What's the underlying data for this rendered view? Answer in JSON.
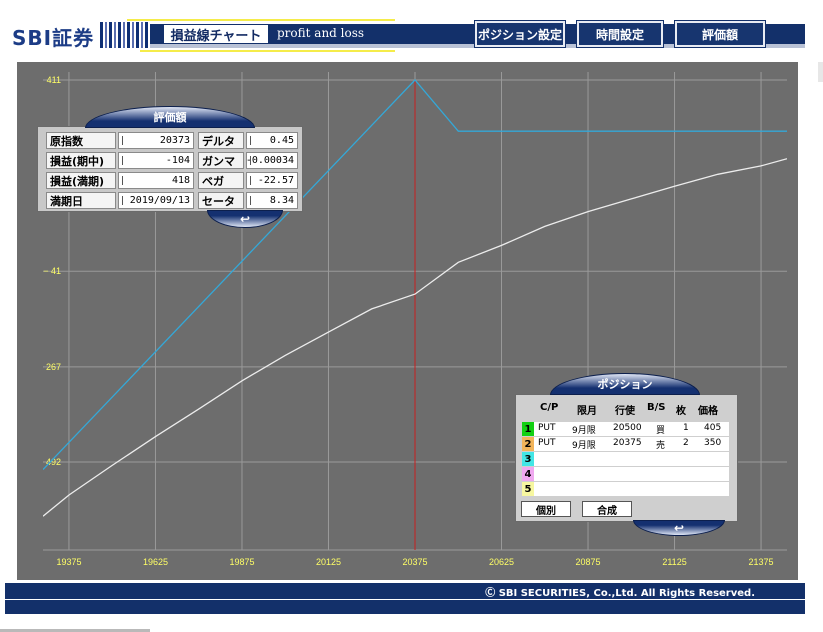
{
  "header": {
    "logo": "SBI証券",
    "title": "損益線チャート",
    "subtitle": "profit and loss",
    "nav": [
      {
        "label": "ポジション設定"
      },
      {
        "label": "時間設定"
      },
      {
        "label": "評価額"
      }
    ]
  },
  "colors": {
    "navy": "#13306a",
    "plot_bg": "#6d6d6d",
    "grid": "#9a9a9a",
    "expiry_line": "#34a8d8",
    "current_line": "#ececec",
    "strike_marker": "#c81e1e",
    "axis_label": "#ffff66"
  },
  "valuation": {
    "title": "評価額",
    "rows": [
      [
        {
          "label": "原指数",
          "value": "20373"
        },
        {
          "label": "デルタ",
          "value": "0.45"
        }
      ],
      [
        {
          "label": "損益(期中)",
          "value": "-104"
        },
        {
          "label": "ガンマ",
          "value": "-0.00034"
        }
      ],
      [
        {
          "label": "損益(満期)",
          "value": "418"
        },
        {
          "label": "ベガ",
          "value": "-22.57"
        }
      ],
      [
        {
          "label": "満期日",
          "value": "2019/09/13"
        },
        {
          "label": "セータ",
          "value": "8.34"
        }
      ]
    ],
    "back_icon": "↩"
  },
  "positions": {
    "title": "ポジション",
    "headers": [
      "C/P",
      "限月",
      "行使",
      "B/S",
      "枚",
      "価格"
    ],
    "rows": [
      {
        "no": "1",
        "cp": "PUT",
        "month": "9月限",
        "strike": "20500",
        "bs": "買",
        "qty": "1",
        "price": "405",
        "color": "#12d012"
      },
      {
        "no": "2",
        "cp": "PUT",
        "month": "9月限",
        "strike": "20375",
        "bs": "売",
        "qty": "2",
        "price": "350",
        "color": "#f2b45a"
      },
      {
        "no": "3",
        "cp": "",
        "month": "",
        "strike": "",
        "bs": "",
        "qty": "",
        "price": "",
        "color": "#43e6e6"
      },
      {
        "no": "4",
        "cp": "",
        "month": "",
        "strike": "",
        "bs": "",
        "qty": "",
        "price": "",
        "color": "#f0a8f0"
      },
      {
        "no": "5",
        "cp": "",
        "month": "",
        "strike": "",
        "bs": "",
        "qty": "",
        "price": "",
        "color": "#f7f7a0"
      }
    ],
    "btn_individual": "個別",
    "btn_combined": "合成",
    "back_icon": "↩"
  },
  "chart_data": {
    "type": "line",
    "x_ticks": [
      "19375",
      "19625",
      "19875",
      "20125",
      "20375",
      "20625",
      "20875",
      "21125",
      "21375"
    ],
    "y_ticks": [
      "411",
      "− 41",
      "− 267",
      "− 492"
    ],
    "xlim": [
      19300,
      21450
    ],
    "ylim": [
      -700,
      411
    ],
    "marker_x": 20375,
    "series": [
      {
        "key": "expiry",
        "x": [
          19300,
          20375,
          20500,
          21450
        ],
        "y": [
          -510,
          411,
          290,
          290
        ]
      },
      {
        "key": "current",
        "x": [
          19300,
          19375,
          19500,
          19625,
          19750,
          19875,
          20000,
          20125,
          20250,
          20375,
          20500,
          20625,
          20750,
          20875,
          21000,
          21125,
          21250,
          21375,
          21450
        ],
        "y": [
          -620,
          -570,
          -500,
          -432,
          -367,
          -300,
          -240,
          -185,
          -130,
          -95,
          -20,
          20,
          65,
          100,
          130,
          160,
          188,
          208,
          225
        ]
      }
    ]
  },
  "footer": {
    "copyright": "Ⓒ SBI SECURITIES, Co.,Ltd. All Rights Reserved."
  }
}
